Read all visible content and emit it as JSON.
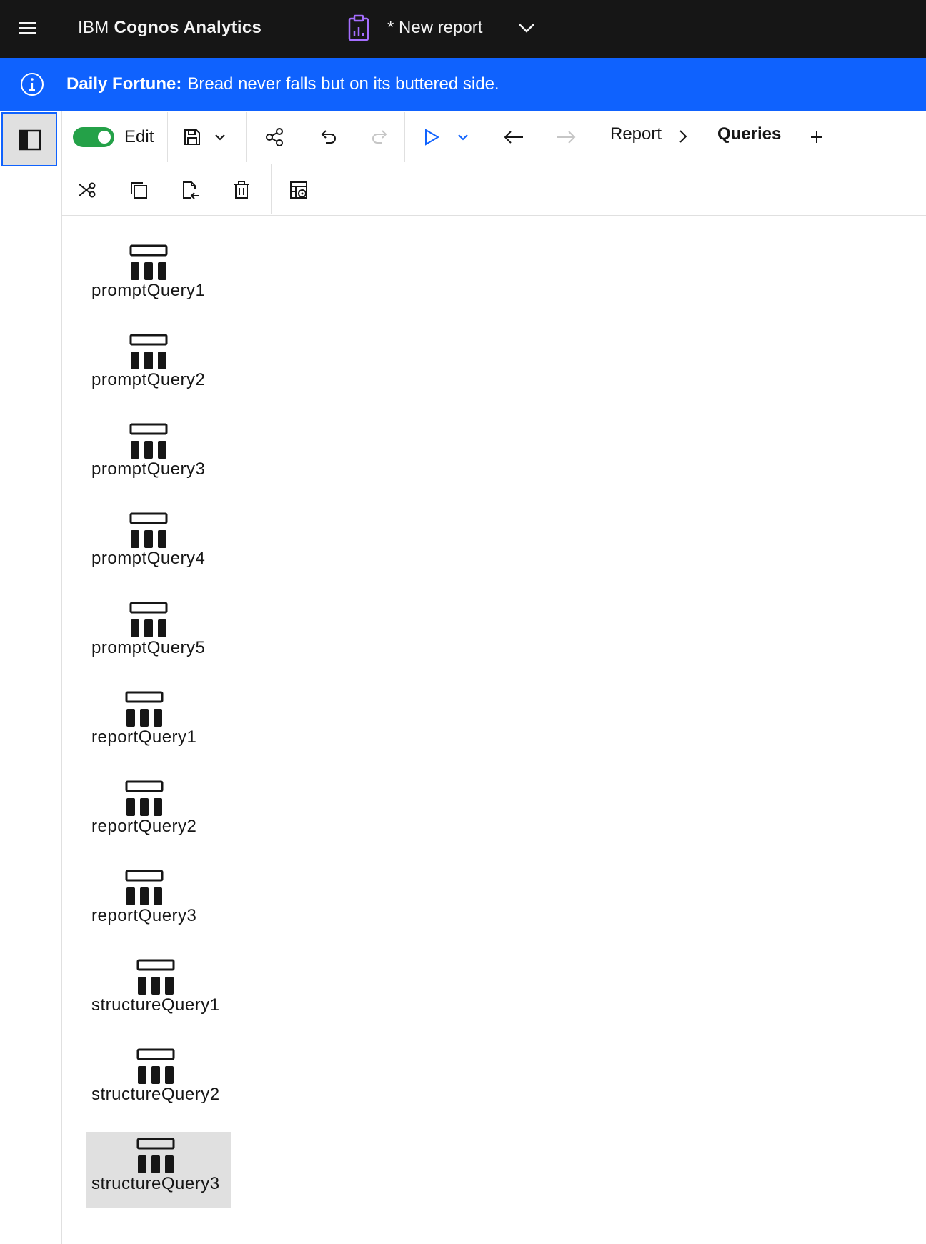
{
  "header": {
    "product_prefix": "IBM ",
    "product_name": "Cognos Analytics",
    "report_title": "* New report"
  },
  "banner": {
    "label": "Daily Fortune:",
    "message": "Bread never falls but on its buttered side."
  },
  "toolbar": {
    "edit_label": "Edit",
    "edit_enabled": true,
    "breadcrumb": [
      "Report",
      "Queries"
    ]
  },
  "queries": [
    {
      "name": "promptQuery1",
      "selected": false
    },
    {
      "name": "promptQuery2",
      "selected": false
    },
    {
      "name": "promptQuery3",
      "selected": false
    },
    {
      "name": "promptQuery4",
      "selected": false
    },
    {
      "name": "promptQuery5",
      "selected": false
    },
    {
      "name": "reportQuery1",
      "selected": false
    },
    {
      "name": "reportQuery2",
      "selected": false
    },
    {
      "name": "reportQuery3",
      "selected": false
    },
    {
      "name": "structureQuery1",
      "selected": false
    },
    {
      "name": "structureQuery2",
      "selected": false
    },
    {
      "name": "structureQuery3",
      "selected": true
    }
  ],
  "colors": {
    "topbar": "#161616",
    "banner": "#0f62fe",
    "toggle_on": "#24a148",
    "run_blue": "#0f62fe",
    "report_icon": "#a56eff",
    "selected_bg": "#e0e0e0"
  },
  "icons": {
    "menu": "hamburger-icon",
    "report": "clipboard-report-icon",
    "info": "info-icon",
    "panel": "side-panel-icon",
    "save": "save-icon",
    "share": "share-icon",
    "undo": "undo-icon",
    "redo": "redo-icon",
    "run": "play-icon",
    "back": "arrow-left-icon",
    "forward": "arrow-right-icon",
    "add": "add-icon",
    "cut": "cut-icon",
    "copy": "copy-icon",
    "paste": "paste-icon",
    "delete": "trash-icon",
    "properties": "table-settings-icon",
    "query": "query-icon"
  }
}
